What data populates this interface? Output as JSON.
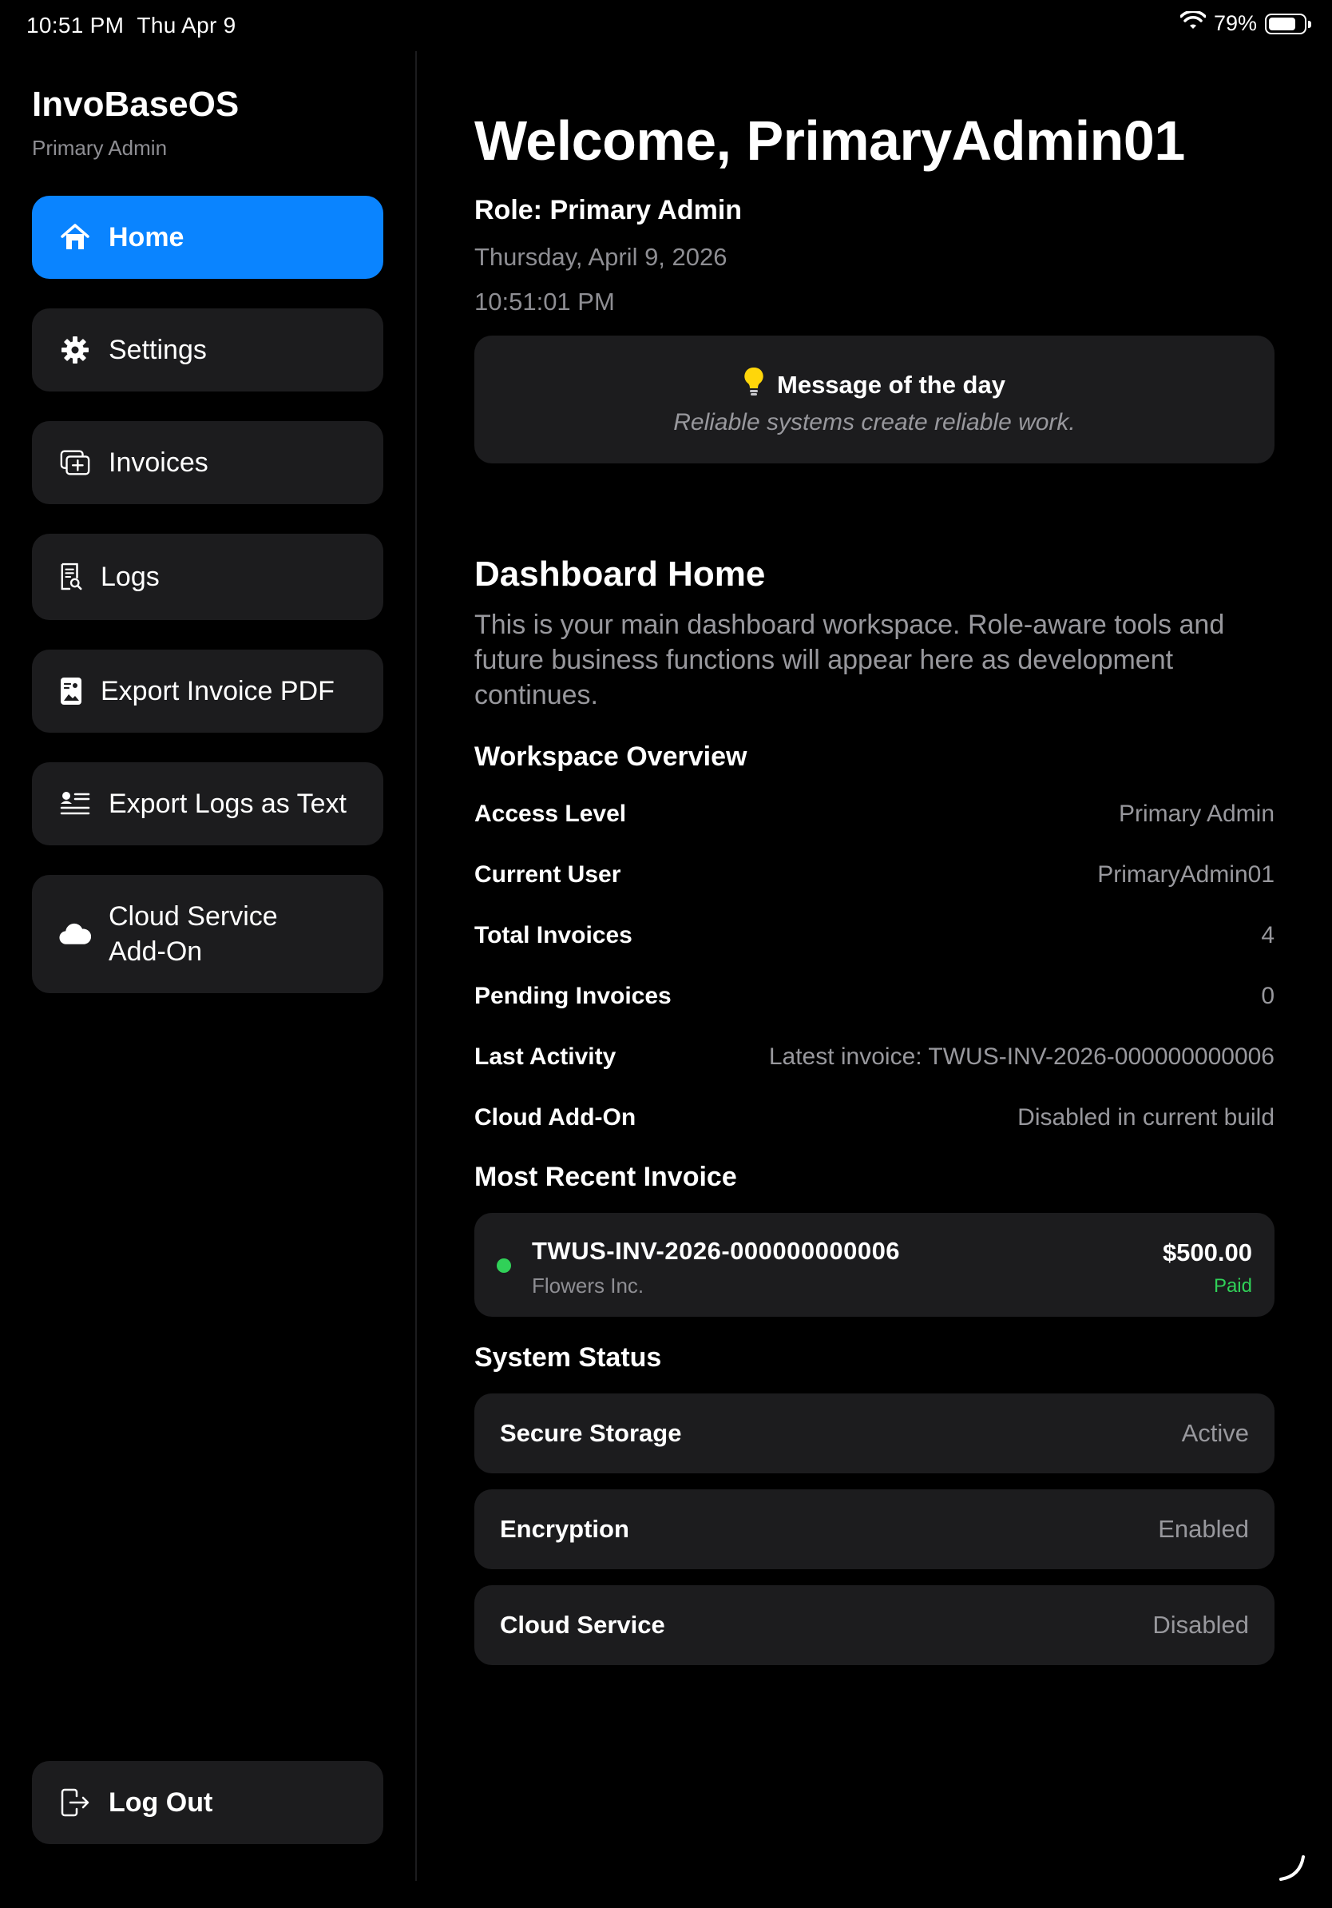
{
  "status_bar": {
    "time": "10:51 PM",
    "date": "Thu Apr 9",
    "battery": "79%",
    "battery_level": 0.79
  },
  "sidebar": {
    "app_title": "InvoBaseOS",
    "app_subtitle": "Primary Admin",
    "items": [
      {
        "label": "Home",
        "icon": "house-icon",
        "active": true
      },
      {
        "label": "Settings",
        "icon": "gear-icon",
        "active": false
      },
      {
        "label": "Invoices",
        "icon": "invoices-icon",
        "active": false
      },
      {
        "label": "Logs",
        "icon": "logs-search-icon",
        "active": false
      },
      {
        "label": "Export Invoice PDF",
        "icon": "export-pdf-icon",
        "active": false
      },
      {
        "label": "Export Logs as Text",
        "icon": "export-text-icon",
        "active": false
      },
      {
        "label": "Cloud Service\nAdd-On",
        "icon": "cloud-icon",
        "active": false
      }
    ],
    "logout_label": "Log Out"
  },
  "main": {
    "welcome": "Welcome, PrimaryAdmin01",
    "role": "Role: Primary Admin",
    "date": "Thursday, April 9, 2026",
    "time": "10:51:01 PM",
    "motd": {
      "title": "Message of the day",
      "text": "Reliable systems create reliable work."
    },
    "dashboard": {
      "title": "Dashboard Home",
      "description": "This is your main dashboard workspace. Role-aware tools and future business functions will appear here as development continues."
    },
    "overview": {
      "heading": "Workspace Overview",
      "rows": [
        {
          "key": "Access Level",
          "value": "Primary Admin"
        },
        {
          "key": "Current User",
          "value": "PrimaryAdmin01"
        },
        {
          "key": "Total Invoices",
          "value": "4"
        },
        {
          "key": "Pending Invoices",
          "value": "0"
        },
        {
          "key": "Last Activity",
          "value": "Latest invoice: TWUS-INV-2026-000000000006"
        },
        {
          "key": "Cloud Add-On",
          "value": "Disabled in current build"
        }
      ]
    },
    "recent_invoice": {
      "heading": "Most Recent Invoice",
      "number": "TWUS-INV-2026-000000000006",
      "client": "Flowers Inc.",
      "amount": "$500.00",
      "status": "Paid",
      "status_color": "#30d158"
    },
    "system_status": {
      "heading": "System Status",
      "items": [
        {
          "key": "Secure Storage",
          "value": "Active"
        },
        {
          "key": "Encryption",
          "value": "Enabled"
        },
        {
          "key": "Cloud Service",
          "value": "Disabled"
        }
      ]
    }
  },
  "colors": {
    "accent": "#0a84ff",
    "card": "#1c1c1e",
    "secondary_text": "#98989d",
    "success": "#30d158",
    "bulb": "#ffd60a"
  }
}
